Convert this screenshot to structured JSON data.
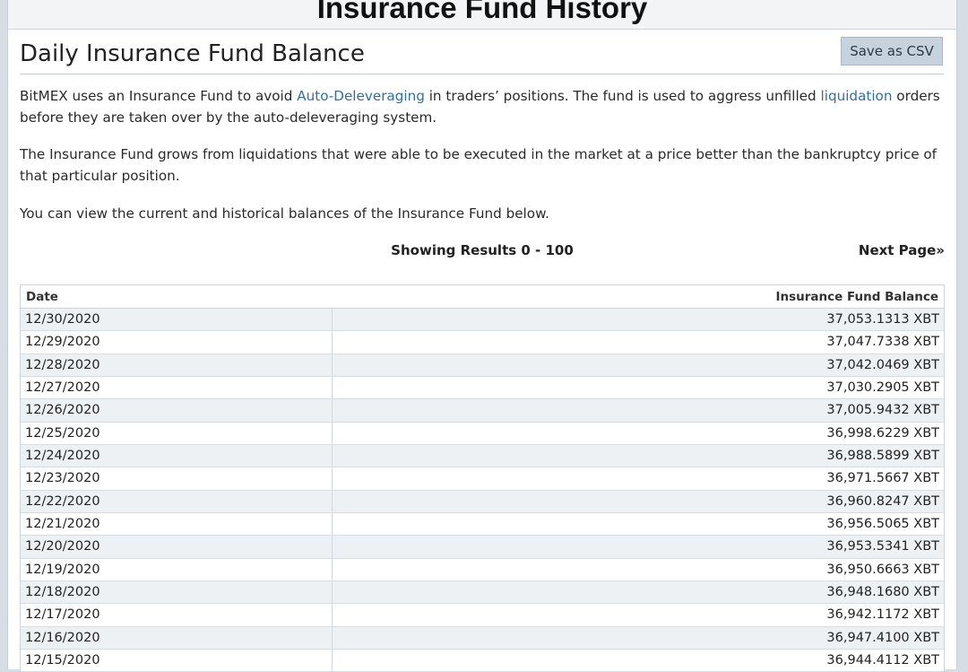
{
  "page": {
    "header_title": "Insurance Fund History",
    "section_title": "Daily Insurance Fund Balance",
    "save_csv_label": "Save as CSV"
  },
  "intro": {
    "p1_before": "BitMEX uses an Insurance Fund to avoid ",
    "p1_link1": "Auto-Deleveraging",
    "p1_middle": " in traders’ positions. The fund is used to aggress unfilled ",
    "p1_link2": "liquidation",
    "p1_after": " orders before they are taken over by the auto-deleveraging system.",
    "p2": "The Insurance Fund grows from liquidations that were able to be executed in the market at a price better than the bankruptcy price of that particular position.",
    "p3": "You can view the current and historical balances of the Insurance Fund below."
  },
  "pagination": {
    "showing": "Showing Results 0 - 100",
    "next_page": "Next Page»"
  },
  "table": {
    "headers": [
      "Date",
      "Insurance Fund Balance"
    ],
    "rows": [
      [
        "12/30/2020",
        "37,053.1313 XBT"
      ],
      [
        "12/29/2020",
        "37,047.7338 XBT"
      ],
      [
        "12/28/2020",
        "37,042.0469 XBT"
      ],
      [
        "12/27/2020",
        "37,030.2905 XBT"
      ],
      [
        "12/26/2020",
        "37,005.9432 XBT"
      ],
      [
        "12/25/2020",
        "36,998.6229 XBT"
      ],
      [
        "12/24/2020",
        "36,988.5899 XBT"
      ],
      [
        "12/23/2020",
        "36,971.5667 XBT"
      ],
      [
        "12/22/2020",
        "36,960.8247 XBT"
      ],
      [
        "12/21/2020",
        "36,956.5065 XBT"
      ],
      [
        "12/20/2020",
        "36,953.5341 XBT"
      ],
      [
        "12/19/2020",
        "36,950.6663 XBT"
      ],
      [
        "12/18/2020",
        "36,948.1680 XBT"
      ],
      [
        "12/17/2020",
        "36,942.1172 XBT"
      ],
      [
        "12/16/2020",
        "36,947.4100 XBT"
      ],
      [
        "12/15/2020",
        "36,944.4112 XBT"
      ]
    ]
  }
}
